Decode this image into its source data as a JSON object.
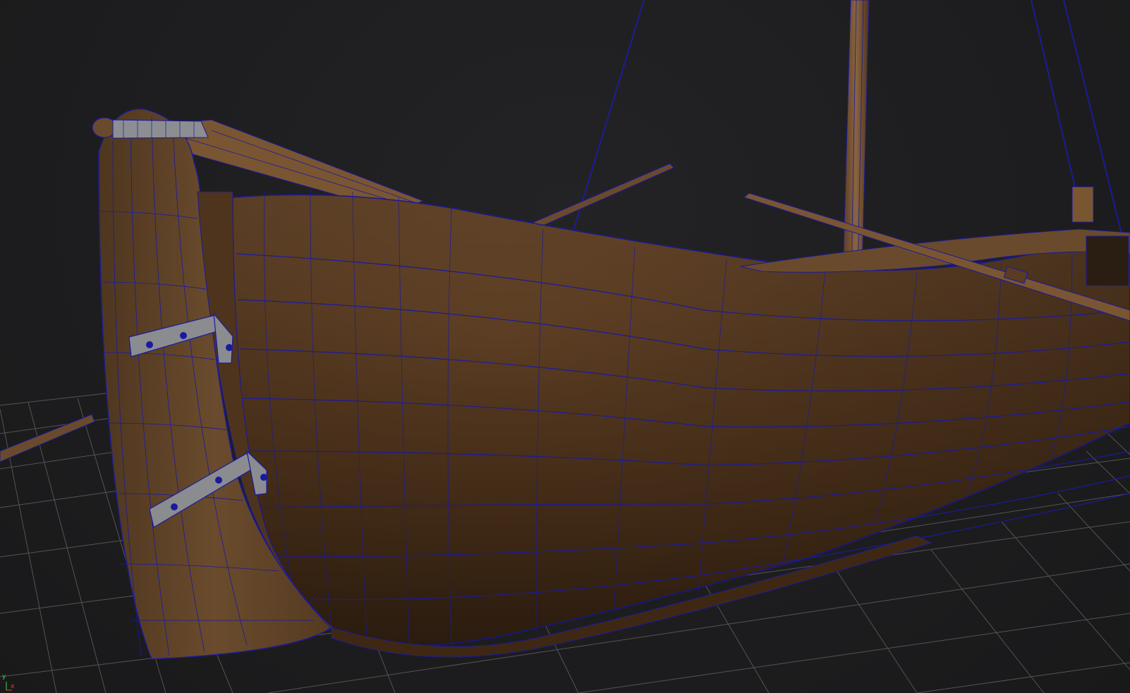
{
  "viewport": {
    "background_color": "#1c1c1e",
    "grid_color": "#6a6a6a",
    "wireframe_color": "#1a1aa0",
    "wood_color": "#5a3c22",
    "wood_highlight": "#7a5535",
    "metal_color": "#8a8c90"
  },
  "axis_gizmo": {
    "y_label": "y",
    "x_label": "x",
    "y_color": "#3fd24a",
    "x_color": "#e0413a"
  }
}
